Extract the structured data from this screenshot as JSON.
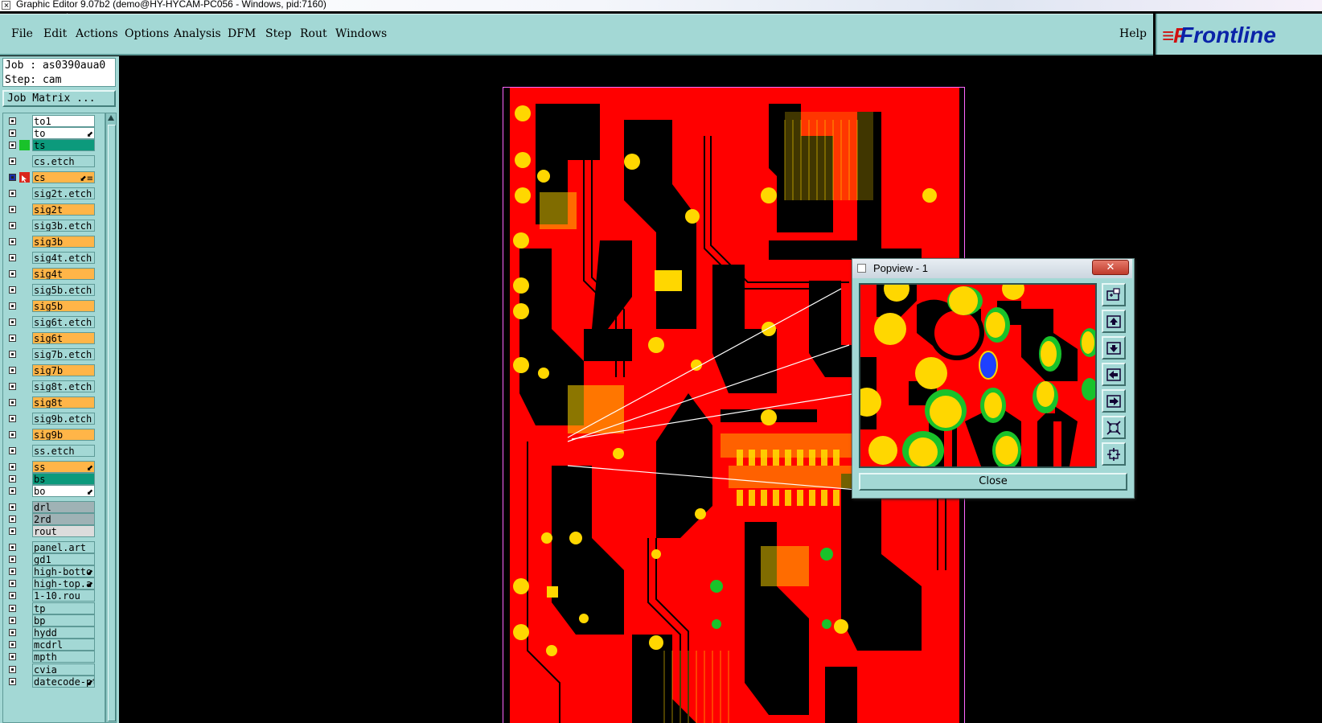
{
  "window": {
    "title": "Graphic Editor 9.07b2 (demo@HY-HYCAM-PC056 - Windows, pid:7160)"
  },
  "menu": {
    "items": [
      "File",
      "Edit",
      "Actions",
      "Options",
      "Analysis",
      "DFM",
      "Step",
      "Rout",
      "Windows"
    ],
    "help": "Help"
  },
  "logo": {
    "mark": "≡F",
    "text": "Frontline"
  },
  "job": {
    "job_line": "Job : as0390aua0",
    "step_line": "Step: cam",
    "matrix_button": "Job Matrix ..."
  },
  "layers": [
    {
      "name": "to1",
      "bg": "#ffffff",
      "mark": ""
    },
    {
      "name": "to",
      "bg": "#ffffff",
      "mark": "⬋"
    },
    {
      "name": "ts",
      "bg": "#0c9a7c",
      "mark": "",
      "swatch": "#19c22a"
    },
    {
      "name": "cs.etch",
      "bg": "#a3d8d5",
      "mark": ""
    },
    {
      "name": "cs",
      "bg": "#ffb548",
      "mark": "⬋≡",
      "active": true
    },
    {
      "name": "sig2t.etch",
      "bg": "#a3d8d5",
      "mark": ""
    },
    {
      "name": "sig2t",
      "bg": "#ffb548",
      "mark": ""
    },
    {
      "name": "sig3b.etch",
      "bg": "#a3d8d5",
      "mark": ""
    },
    {
      "name": "sig3b",
      "bg": "#ffb548",
      "mark": ""
    },
    {
      "name": "sig4t.etch",
      "bg": "#a3d8d5",
      "mark": ""
    },
    {
      "name": "sig4t",
      "bg": "#ffb548",
      "mark": ""
    },
    {
      "name": "sig5b.etch",
      "bg": "#a3d8d5",
      "mark": ""
    },
    {
      "name": "sig5b",
      "bg": "#ffb548",
      "mark": ""
    },
    {
      "name": "sig6t.etch",
      "bg": "#a3d8d5",
      "mark": ""
    },
    {
      "name": "sig6t",
      "bg": "#ffb548",
      "mark": ""
    },
    {
      "name": "sig7b.etch",
      "bg": "#a3d8d5",
      "mark": ""
    },
    {
      "name": "sig7b",
      "bg": "#ffb548",
      "mark": ""
    },
    {
      "name": "sig8t.etch",
      "bg": "#a3d8d5",
      "mark": ""
    },
    {
      "name": "sig8t",
      "bg": "#ffb548",
      "mark": ""
    },
    {
      "name": "sig9b.etch",
      "bg": "#a3d8d5",
      "mark": ""
    },
    {
      "name": "sig9b",
      "bg": "#ffb548",
      "mark": ""
    },
    {
      "name": "ss.etch",
      "bg": "#a3d8d5",
      "mark": ""
    },
    {
      "name": "ss",
      "bg": "#ffb548",
      "mark": "⬋"
    },
    {
      "name": "bs",
      "bg": "#0c9a7c",
      "mark": ""
    },
    {
      "name": "bo",
      "bg": "#ffffff",
      "mark": "⬋"
    },
    {
      "name": "drl",
      "bg": "#9fb2b5",
      "mark": ""
    },
    {
      "name": "2rd",
      "bg": "#9fb2b5",
      "mark": ""
    },
    {
      "name": "rout",
      "bg": "#dcdcdc",
      "mark": ""
    },
    {
      "name": "panel.art",
      "bg": "#a3d8d5",
      "mark": ""
    },
    {
      "name": "gd1",
      "bg": "#a3d8d5",
      "mark": ""
    },
    {
      "name": "high-botto",
      "bg": "#a3d8d5",
      "mark": "⬋"
    },
    {
      "name": "high-top.a",
      "bg": "#a3d8d5",
      "mark": "⬋"
    },
    {
      "name": "1-10.rou",
      "bg": "#a3d8d5",
      "mark": ""
    },
    {
      "name": "tp",
      "bg": "#a3d8d5",
      "mark": ""
    },
    {
      "name": "bp",
      "bg": "#a3d8d5",
      "mark": ""
    },
    {
      "name": "hydd",
      "bg": "#a3d8d5",
      "mark": ""
    },
    {
      "name": "mcdrl",
      "bg": "#a3d8d5",
      "mark": ""
    },
    {
      "name": "mpth",
      "bg": "#a3d8d5",
      "mark": ""
    },
    {
      "name": "cvia",
      "bg": "#a3d8d5",
      "mark": ""
    },
    {
      "name": "datecode-pt",
      "bg": "#a3d8d5",
      "mark": "⬋"
    }
  ],
  "popview": {
    "title": "Popview - 1",
    "close_label": "Close",
    "tools": [
      "zoom-fit-icon",
      "pan-up-icon",
      "pan-down-icon",
      "pan-left-icon",
      "pan-right-icon",
      "zoom-in-icon",
      "zoom-out-icon"
    ]
  },
  "colors": {
    "panel": "#a3d8d5",
    "copper": "#ff0000",
    "pad": "#ffd700",
    "mask": "#19c22a",
    "selected": "#1e40ff"
  }
}
